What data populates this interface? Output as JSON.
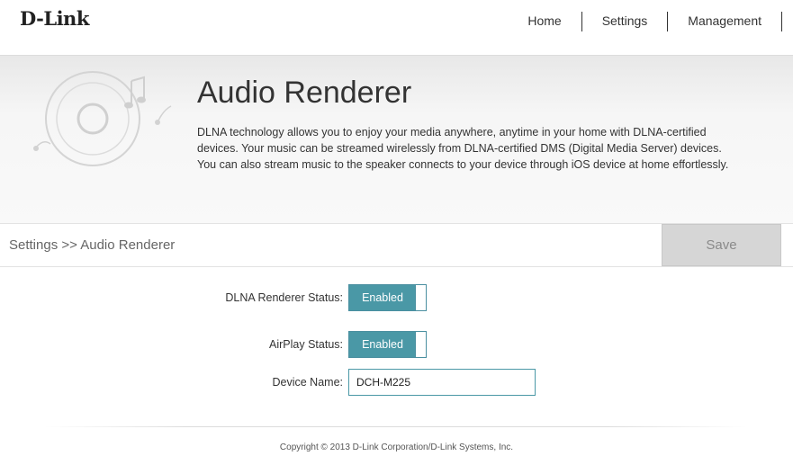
{
  "brand": {
    "logo_text": "D-Link"
  },
  "nav": {
    "items": [
      "Home",
      "Settings",
      "Management"
    ]
  },
  "banner": {
    "title": "Audio Renderer",
    "description_lines": [
      "DLNA technology allows you to enjoy your media anywhere, anytime in your home with DLNA-certified",
      "devices. Your music can be streamed wirelessly from DLNA-certified DMS (Digital Media Server) devices.",
      "You can also stream music to the speaker connects to your device through iOS device at home effortlessly."
    ],
    "icon": "speaker-music-icon"
  },
  "breadcrumb": "Settings >> Audio Renderer",
  "toolbar": {
    "save_label": "Save"
  },
  "form": {
    "dlna_status": {
      "label": "DLNA Renderer Status:",
      "value": "Enabled"
    },
    "airplay_status": {
      "label": "AirPlay Status:",
      "value": "Enabled"
    },
    "device_name": {
      "label": "Device Name:",
      "value": "DCH-M225"
    }
  },
  "footer": {
    "copyright": "Copyright © 2013 D-Link Corporation/D-Link Systems, Inc."
  },
  "colors": {
    "accent": "#4a98a6",
    "save_bg": "#d6d6d6"
  }
}
